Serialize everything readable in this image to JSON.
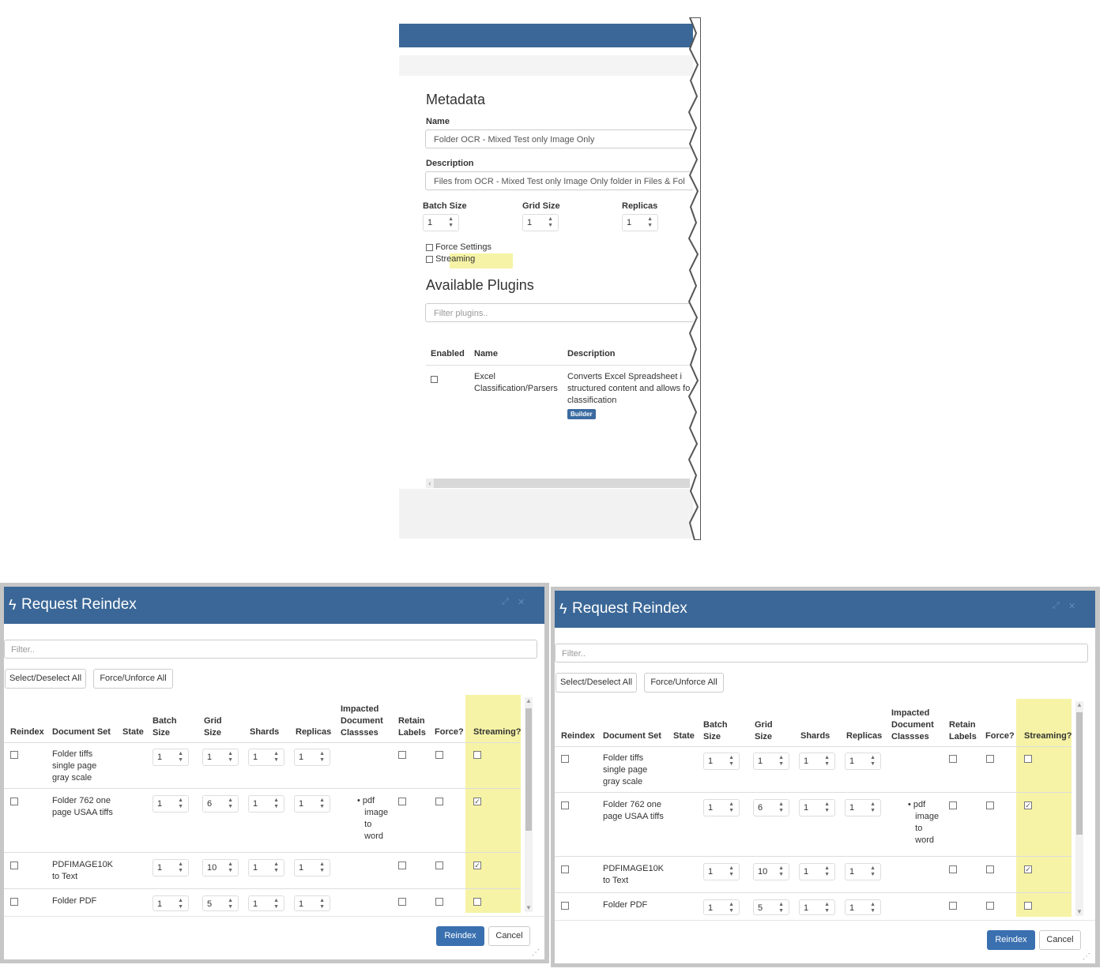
{
  "snippet": {
    "metadata_title": "Metadata",
    "name_label": "Name",
    "name_value": "Folder OCR - Mixed Test only Image Only",
    "description_label": "Description",
    "description_value": "Files from OCR - Mixed Test only Image Only folder in Files & Fol",
    "batch_size_label": "Batch Size",
    "batch_size_value": "1",
    "grid_size_label": "Grid Size",
    "grid_size_value": "1",
    "replicas_label": "Replicas",
    "replicas_value": "1",
    "force_settings_label": "Force Settings",
    "streaming_label": "Streaming",
    "plugins_title": "Available Plugins",
    "filter_placeholder": "Filter plugins..",
    "col_enabled": "Enabled",
    "col_name": "Name",
    "col_description": "Description",
    "plugin_name_1": "Excel",
    "plugin_name_2": "Classification/Parsers",
    "plugin_desc_1": "Converts Excel Spreadsheet i",
    "plugin_desc_2": "structured content and allows fo",
    "plugin_desc_3": "classification",
    "plugin_badge": "Builder"
  },
  "dialog": {
    "title": "Request Reindex",
    "filter_placeholder": "Filter..",
    "select_all": "Select/Deselect All",
    "force_all": "Force/Unforce All",
    "columns": {
      "reindex": "Reindex",
      "document_set": "Document Set",
      "state": "State",
      "batch_1": "Batch",
      "batch_2": "Size",
      "grid_1": "Grid",
      "grid_2": "Size",
      "shards": "Shards",
      "replicas": "Replicas",
      "impacted_1": "Impacted",
      "impacted_2": "Document",
      "impacted_3": "Classses",
      "retain_1": "Retain",
      "retain_2": "Labels",
      "force": "Force?",
      "streaming": "Streaming?"
    },
    "rows": [
      {
        "name_1": "Folder tiffs",
        "name_2": "single page",
        "name_3": "gray scale",
        "batch": "1",
        "grid": "1",
        "shards": "1",
        "replicas": "1",
        "streaming": false
      },
      {
        "name_1": "Folder 762 one",
        "name_2": "page USAA tiffs",
        "batch": "1",
        "grid": "6",
        "shards": "1",
        "replicas": "1",
        "impacted_1": "pdf",
        "impacted_2": "image",
        "impacted_3": "to",
        "impacted_4": "word",
        "streaming": true
      },
      {
        "name_1": "PDFIMAGE10K",
        "name_2": "to Text",
        "batch": "1",
        "grid": "10",
        "shards": "1",
        "replicas": "1",
        "streaming": true
      },
      {
        "name_1": "Folder PDF",
        "batch": "1",
        "grid": "5",
        "shards": "1",
        "replicas": "1",
        "streaming": false
      }
    ],
    "reindex_button": "Reindex",
    "cancel_button": "Cancel"
  },
  "colors": {
    "header_blue": "#3a6797",
    "primary_button": "#3a70b0",
    "highlight_yellow": "#f6f3a6"
  },
  "icons": [
    "bolt-icon",
    "expand-icon",
    "close-icon",
    "spinner-arrows-icon",
    "checkbox-icon",
    "resize-handle-icon"
  ]
}
